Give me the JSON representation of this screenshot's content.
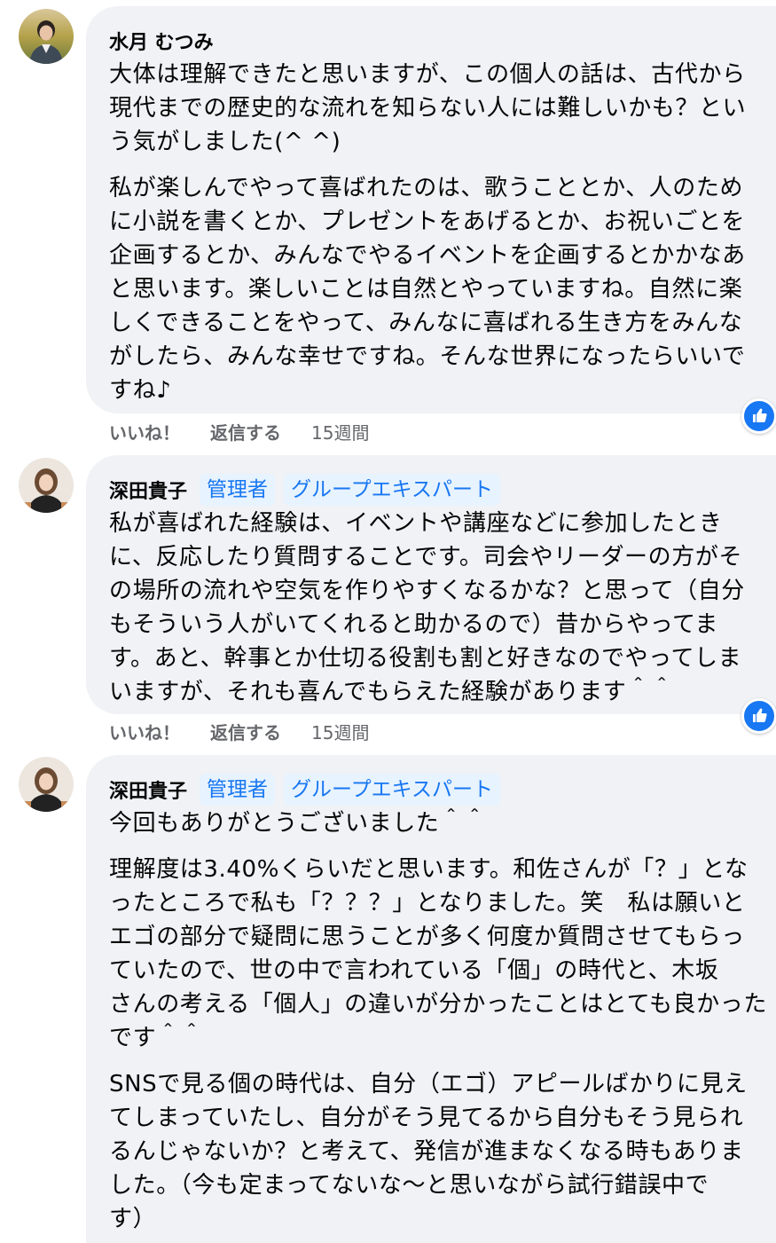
{
  "comments": [
    {
      "author": "水月 むつみ",
      "badges": [],
      "paragraphs": [
        "大体は理解できたと思いますが、この個人の話は、古代から\n現代までの歴史的な流れを知らない人には難しいかも？とい\nう気がしました(^ ^)",
        "私が楽しんでやって喜ばれたのは、歌うこととか、人のため\nに小説を書くとか、プレゼントをあげるとか、お祝いごとを\n企画するとか、みんなでやるイベントを企画するとかかなあ\nと思います。楽しいことは自然とやっていますね。自然に楽\nしくできることをやって、みんなに喜ばれる生き方をみんな\nがしたら、みんな幸せですね。そんな世界になったらいいで\nすね♪"
      ],
      "actions": {
        "like": "いいね！",
        "reply": "返信する",
        "time": "15週間"
      }
    },
    {
      "author": "深田貴子",
      "badges": [
        "管理者",
        "グループエキスパート"
      ],
      "paragraphs": [
        "私が喜ばれた経験は、イベントや講座などに参加したとき\nに、反応したり質問することです。司会やリーダーの方がそ\nの場所の流れや空気を作りやすくなるかな？と思って（自分\nもそういう人がいてくれると助かるので）昔からやってま\nす。あと、幹事とか仕切る役割も割と好きなのでやってしま\nいますが、それも喜んでもらえた経験があります＾＾"
      ],
      "actions": {
        "like": "いいね！",
        "reply": "返信する",
        "time": "15週間"
      }
    },
    {
      "author": "深田貴子",
      "badges": [
        "管理者",
        "グループエキスパート"
      ],
      "paragraphs": [
        "今回もありがとうございました＾＾",
        "理解度は3.40%くらいだと思います。和佐さんが「？」とな\nったところで私も「？？？」となりました。笑　私は願いと\nエゴの部分で疑問に思うことが多く何度か質問させてもらっ\nていたので、世の中で言われている「個」の時代と、木坂\nさんの考える「個人」の違いが分かったことはとても良かった\nです＾＾",
        "SNSで見る個の時代は、自分（エゴ）アピールばかりに見え\nてしまっていたし、自分がそう見てるから自分もそう見られ\nるんじゃないか？と考えて、発信が進まなくなる時もありま\nした。（今も定まってないな〜と思いながら試行錯誤中で\nす）"
      ]
    }
  ],
  "colors": {
    "bubble": "#f0f2f5",
    "badge_bg": "#e7f3ff",
    "badge_text": "#1877f2",
    "meta_text": "#65676b",
    "like_badge": "#1877f2"
  },
  "icons": {
    "reaction": "like-thumbs-up-icon"
  }
}
